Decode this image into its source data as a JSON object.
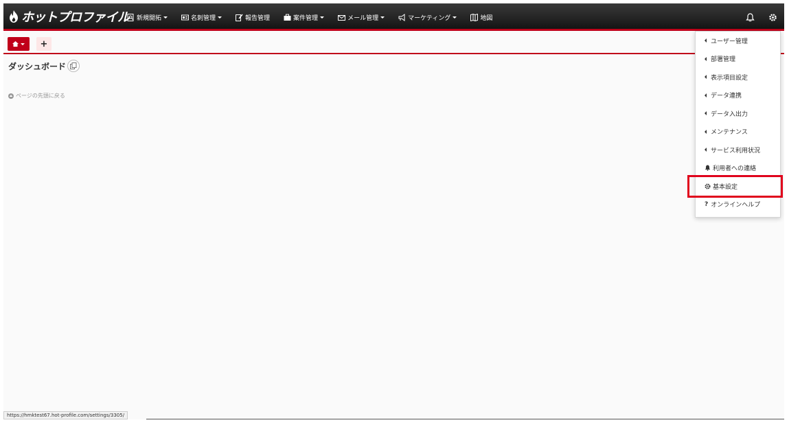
{
  "app": {
    "brand": "ホットプロファイル"
  },
  "nav": {
    "items": [
      {
        "label": "新規開拓",
        "icon": "search-doc-icon",
        "caret": true
      },
      {
        "label": "名刺管理",
        "icon": "card-icon",
        "caret": true
      },
      {
        "label": "報告管理",
        "icon": "report-edit-icon",
        "caret": false
      },
      {
        "label": "案件管理",
        "icon": "briefcase-icon",
        "caret": true
      },
      {
        "label": "メール管理",
        "icon": "mail-icon",
        "caret": true
      },
      {
        "label": "マーケティング",
        "icon": "megaphone-icon",
        "caret": true
      },
      {
        "label": "地図",
        "icon": "map-icon",
        "caret": false
      }
    ]
  },
  "tabs": {
    "add_label": "+"
  },
  "page": {
    "title": "ダッシュボード",
    "back_to_top": "ページの先頭に戻る"
  },
  "settings_menu": {
    "items": [
      {
        "label": "ユーザー管理",
        "icon": "caret-left-icon"
      },
      {
        "label": "部署管理",
        "icon": "caret-left-icon"
      },
      {
        "label": "表示項目設定",
        "icon": "caret-left-icon"
      },
      {
        "label": "データ連携",
        "icon": "caret-left-icon"
      },
      {
        "label": "データ入出力",
        "icon": "caret-left-icon"
      },
      {
        "label": "メンテナンス",
        "icon": "caret-left-icon"
      },
      {
        "label": "サービス利用状況",
        "icon": "caret-left-icon"
      },
      {
        "label": "利用者への連絡",
        "icon": "bell-icon"
      },
      {
        "label": "基本設定",
        "icon": "gear-icon",
        "highlighted": true
      },
      {
        "label": "オンラインヘルプ",
        "icon": "question-icon"
      }
    ]
  },
  "status_bar": {
    "url": "https://hmktest67.hot-profile.com/settings/3305/"
  },
  "colors": {
    "accent": "#c0001a",
    "highlight": "#e0001b",
    "navbar": "#1e1e1e"
  }
}
